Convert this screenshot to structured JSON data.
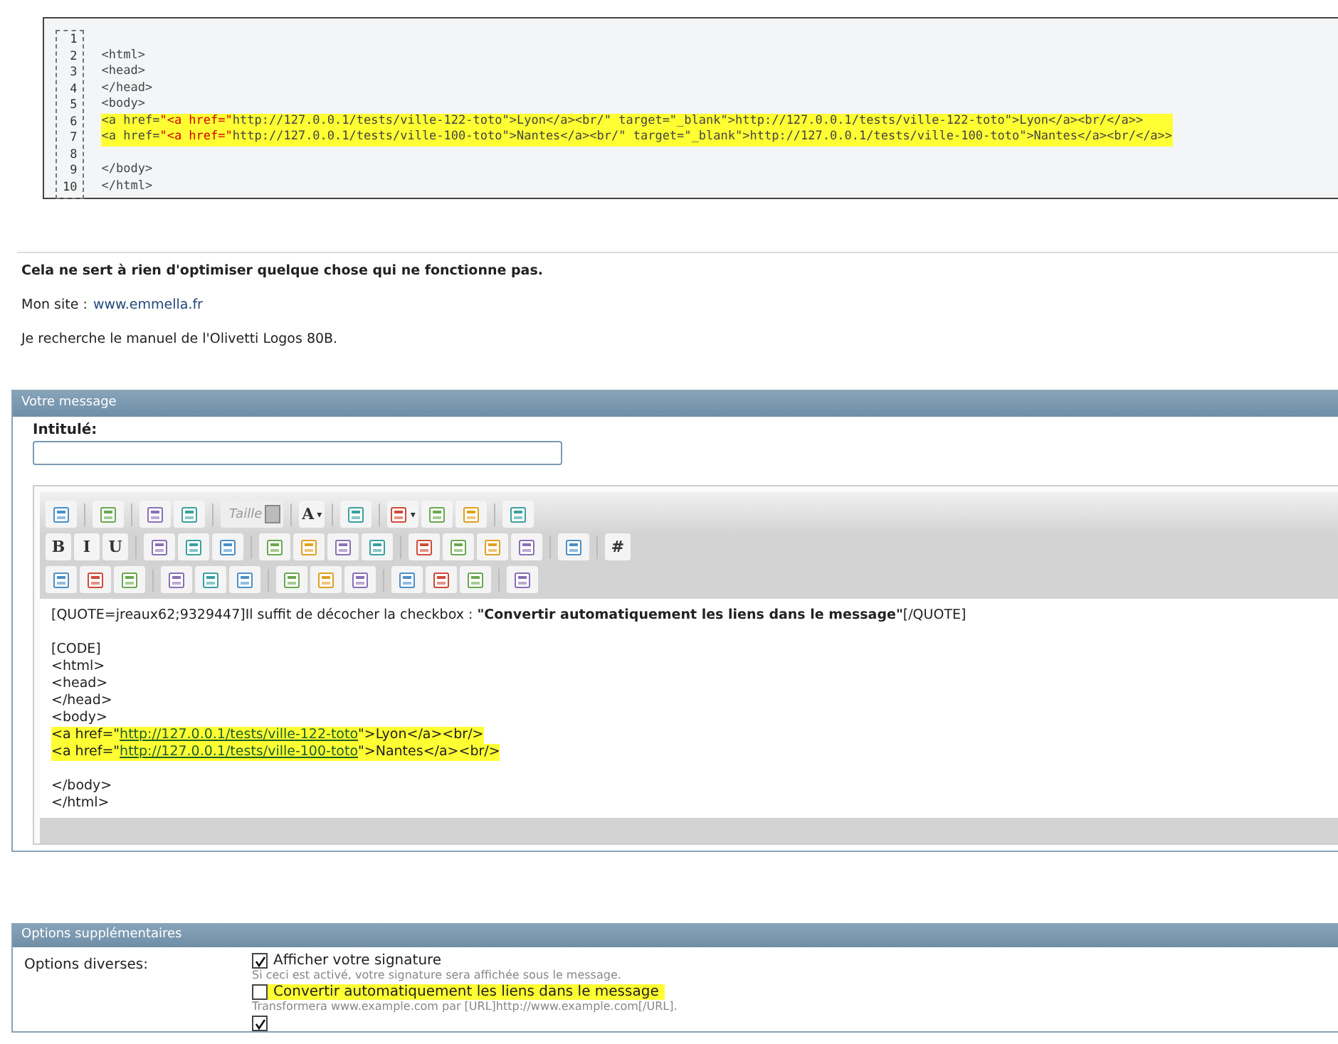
{
  "code_block": {
    "lines": [
      {
        "number": "1",
        "highlighted": false
      },
      {
        "number": "2",
        "highlighted": false,
        "segments": [
          {
            "text": "<html>",
            "kind": "plain"
          }
        ]
      },
      {
        "number": "3",
        "highlighted": false,
        "segments": [
          {
            "text": "<head>",
            "kind": "plain"
          }
        ]
      },
      {
        "number": "4",
        "highlighted": false,
        "segments": [
          {
            "text": "</head>",
            "kind": "plain"
          }
        ]
      },
      {
        "number": "5",
        "highlighted": false,
        "segments": [
          {
            "text": "<body>",
            "kind": "plain"
          }
        ]
      },
      {
        "number": "6",
        "highlighted": true,
        "segments": [
          {
            "text": "<a href=",
            "kind": "plain"
          },
          {
            "text": "\"<a href=\"",
            "kind": "string"
          },
          {
            "text": "http://127.0.0.1/tests/ville-122-toto\">Lyon</a><br/\" target=\"_blank\">http://127.0.0.1/tests/ville-122-toto\">Lyon</a><br/</a>>",
            "kind": "plain"
          }
        ]
      },
      {
        "number": "7",
        "highlighted": true,
        "segments": [
          {
            "text": "<a href=",
            "kind": "plain"
          },
          {
            "text": "\"<a href=\"",
            "kind": "string"
          },
          {
            "text": "http://127.0.0.1/tests/ville-100-toto\">Nantes</a><br/\" target=\"_blank\">http://127.0.0.1/tests/ville-100-toto\">Nantes</a><br/</a>>",
            "kind": "plain"
          }
        ]
      },
      {
        "number": "8",
        "highlighted": false
      },
      {
        "number": "9",
        "highlighted": false,
        "segments": [
          {
            "text": "</body>",
            "kind": "plain"
          }
        ]
      },
      {
        "number": "10",
        "highlighted": false,
        "segments": [
          {
            "text": "</html>",
            "kind": "plain"
          }
        ]
      }
    ]
  },
  "signature": {
    "motto": "Cela ne sert à rien d'optimiser quelque chose qui ne fonctionne pas.",
    "site_label": "Mon site :",
    "site_link": "www.emmella.fr",
    "note": "Je recherche le manuel de l'Olivetti Logos 80B."
  },
  "message_panel": {
    "title": "Votre message",
    "subject_label": "Intitulé:",
    "toolbar": [
      [
        {
          "kind": "icon"
        },
        {
          "kind": "sep"
        },
        {
          "kind": "icon"
        },
        {
          "kind": "sep"
        },
        {
          "kind": "icon"
        },
        {
          "kind": "icon"
        },
        {
          "kind": "sep"
        },
        {
          "kind": "dropdown",
          "label": "Taille"
        },
        {
          "kind": "sep"
        },
        {
          "kind": "text",
          "label": "A",
          "caret": "▾"
        },
        {
          "kind": "sep"
        },
        {
          "kind": "icon"
        },
        {
          "kind": "sep"
        },
        {
          "kind": "icon",
          "caret": "▾"
        },
        {
          "kind": "icon"
        },
        {
          "kind": "icon"
        },
        {
          "kind": "sep"
        },
        {
          "kind": "icon"
        }
      ],
      [
        {
          "kind": "text",
          "label": "B"
        },
        {
          "kind": "text",
          "label": "I"
        },
        {
          "kind": "text",
          "label": "U"
        },
        {
          "kind": "sep"
        },
        {
          "kind": "icon"
        },
        {
          "kind": "icon"
        },
        {
          "kind": "icon"
        },
        {
          "kind": "sep"
        },
        {
          "kind": "icon"
        },
        {
          "kind": "icon"
        },
        {
          "kind": "icon"
        },
        {
          "kind": "icon"
        },
        {
          "kind": "sep"
        },
        {
          "kind": "icon"
        },
        {
          "kind": "icon"
        },
        {
          "kind": "icon"
        },
        {
          "kind": "icon"
        },
        {
          "kind": "sep"
        },
        {
          "kind": "icon"
        },
        {
          "kind": "sep"
        },
        {
          "kind": "text",
          "label": "#"
        }
      ],
      [
        {
          "kind": "icon"
        },
        {
          "kind": "icon"
        },
        {
          "kind": "icon"
        },
        {
          "kind": "sep"
        },
        {
          "kind": "icon"
        },
        {
          "kind": "icon"
        },
        {
          "kind": "icon"
        },
        {
          "kind": "sep"
        },
        {
          "kind": "icon"
        },
        {
          "kind": "icon"
        },
        {
          "kind": "icon"
        },
        {
          "kind": "sep"
        },
        {
          "kind": "icon"
        },
        {
          "kind": "icon"
        },
        {
          "kind": "icon"
        },
        {
          "kind": "sep"
        },
        {
          "kind": "icon"
        }
      ]
    ],
    "editor_lines": [
      {
        "highlighted": false,
        "segments": [
          {
            "text": "[QUOTE=jreaux62;9329447]Il suffit de décocher la checkbox : **\"Convertir automatiquement les liens dans le message\"**[/QUOTE]",
            "kind": "plain"
          }
        ]
      },
      {
        "highlighted": false
      },
      {
        "highlighted": false,
        "segments": [
          {
            "text": "[CODE]",
            "kind": "plain"
          }
        ]
      },
      {
        "highlighted": false,
        "segments": [
          {
            "text": "<html>",
            "kind": "plain"
          }
        ]
      },
      {
        "highlighted": false,
        "segments": [
          {
            "text": "<head>",
            "kind": "plain"
          }
        ]
      },
      {
        "highlighted": false,
        "segments": [
          {
            "text": "</head>",
            "kind": "plain"
          }
        ]
      },
      {
        "highlighted": false,
        "segments": [
          {
            "text": "<body>",
            "kind": "plain"
          }
        ]
      },
      {
        "highlighted": true,
        "segments": [
          {
            "text": "<a href=\"",
            "kind": "plain"
          },
          {
            "text": "http://127.0.0.1/tests/ville-122-toto",
            "kind": "link"
          },
          {
            "text": "\">Lyon</a><br/>",
            "kind": "plain"
          }
        ]
      },
      {
        "highlighted": true,
        "segments": [
          {
            "text": "<a href=\"",
            "kind": "plain"
          },
          {
            "text": "http://127.0.0.1/tests/ville-100-toto",
            "kind": "link"
          },
          {
            "text": "\">Nantes</a><br/>",
            "kind": "plain"
          }
        ]
      },
      {
        "highlighted": false
      },
      {
        "highlighted": false,
        "segments": [
          {
            "text": "</body>",
            "kind": "plain"
          }
        ]
      },
      {
        "highlighted": false,
        "segments": [
          {
            "text": "</html>",
            "kind": "plain"
          }
        ]
      }
    ]
  },
  "options_panel": {
    "title": "Options supplémentaires",
    "group_label": "Options diverses:",
    "options": [
      {
        "label": "Afficher votre signature",
        "checked": true,
        "highlighted": false,
        "hint": "Si ceci est activé, votre signature sera affichée sous le message."
      },
      {
        "label": "Convertir automatiquement les liens dans le message",
        "checked": false,
        "highlighted": true,
        "hint": "Transformera www.example.com par [URL]http://www.example.com[/URL]."
      },
      {
        "checked": true,
        "highlighted": false
      }
    ]
  }
}
